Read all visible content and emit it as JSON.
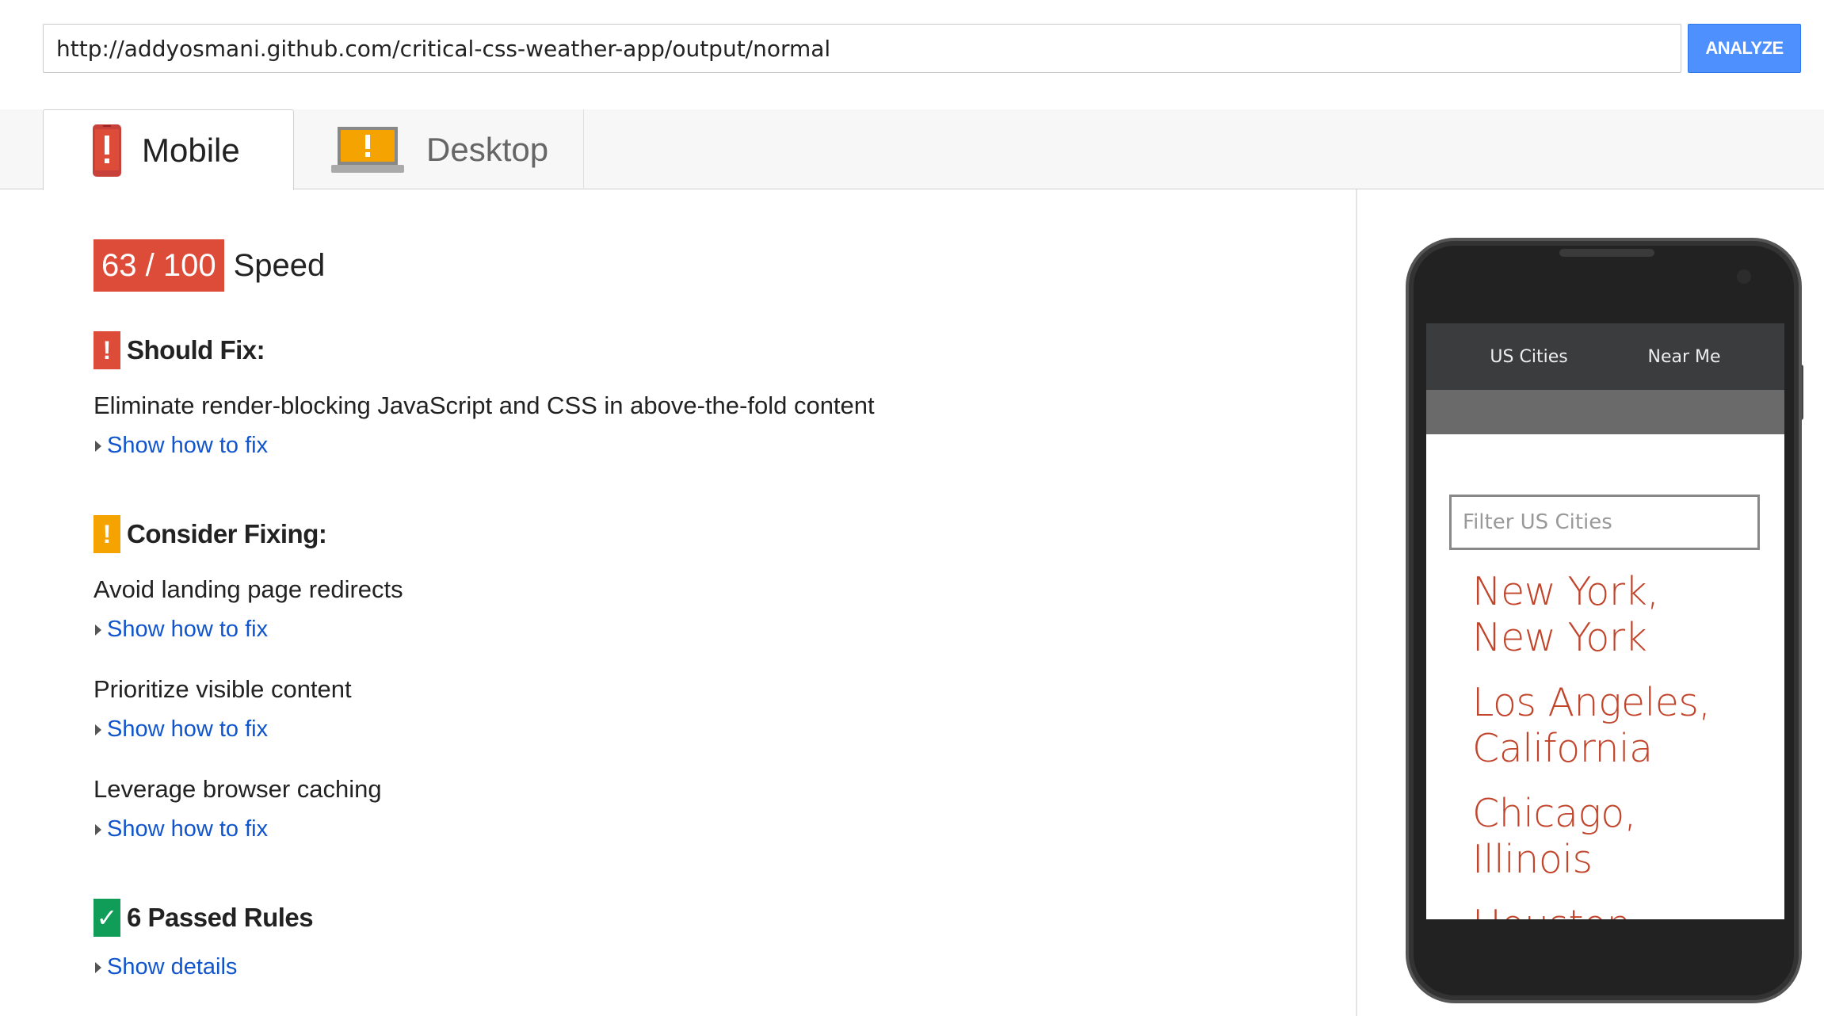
{
  "url_bar": {
    "value": "http://addyosmani.github.com/critical-css-weather-app/output/normal",
    "analyze_label": "ANALYZE"
  },
  "tabs": [
    {
      "label": "Mobile",
      "icon": "mobile-warning-icon",
      "selected": true
    },
    {
      "label": "Desktop",
      "icon": "laptop-warning-icon",
      "selected": false
    }
  ],
  "score": {
    "value": "63 / 100",
    "label": "Speed",
    "color": "#dd4b39"
  },
  "should_fix": {
    "title": "Should Fix:",
    "icon_glyph": "!",
    "color": "#dd4b39",
    "rules": [
      {
        "title": "Eliminate render-blocking JavaScript and CSS in above-the-fold content",
        "link": "Show how to fix"
      }
    ]
  },
  "consider_fixing": {
    "title": "Consider Fixing:",
    "icon_glyph": "!",
    "color": "#f4a300",
    "rules": [
      {
        "title": "Avoid landing page redirects",
        "link": "Show how to fix"
      },
      {
        "title": "Prioritize visible content",
        "link": "Show how to fix"
      },
      {
        "title": "Leverage browser caching",
        "link": "Show how to fix"
      }
    ]
  },
  "passed": {
    "title": "6 Passed Rules",
    "icon_glyph": "✓",
    "color": "#0f9d58",
    "link": "Show details"
  },
  "phone_preview": {
    "nav": [
      "US Cities",
      "Near Me"
    ],
    "filter_placeholder": "Filter US Cities",
    "cities": [
      {
        "line1": "New York,",
        "line2": "New York"
      },
      {
        "line1": "Los Angeles,",
        "line2": "California"
      },
      {
        "line1": "Chicago,",
        "line2": "Illinois"
      },
      {
        "line1": "Houston,",
        "line2": ""
      }
    ],
    "accent_color": "#c1442b"
  },
  "colors": {
    "link": "#1155cc",
    "analyze_button": "#4d90fe"
  }
}
